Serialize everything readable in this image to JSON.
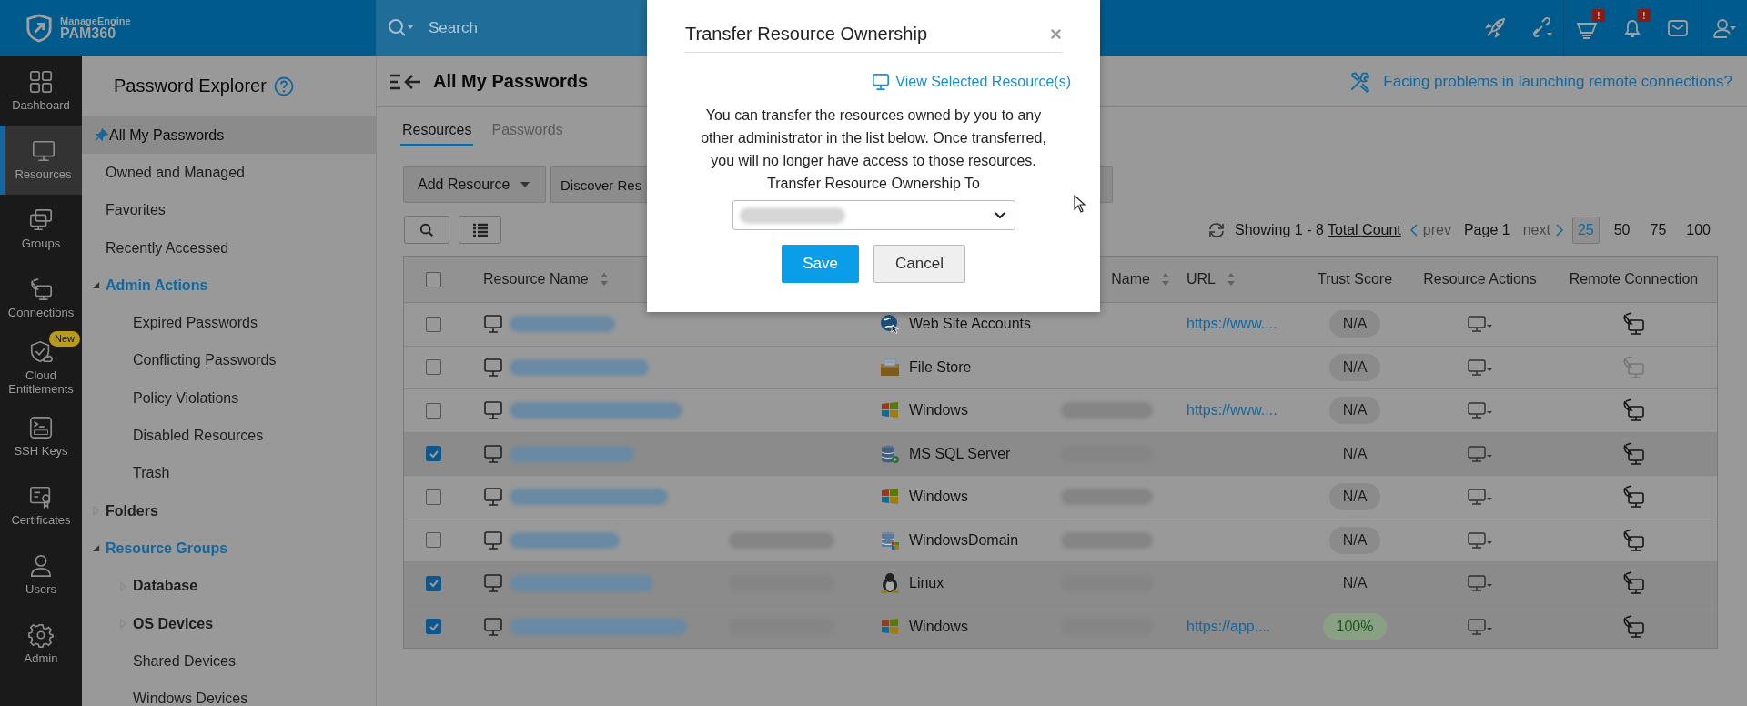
{
  "top_bar": {
    "logo_brand": "ManageEngine",
    "logo_product": "PAM360",
    "search_placeholder": "Search",
    "basket_badge": "!",
    "bell_badge": "!"
  },
  "nav_rail": [
    {
      "label": "Dashboard",
      "selected": false
    },
    {
      "label": "Resources",
      "selected": true
    },
    {
      "label": "Groups",
      "selected": false
    },
    {
      "label": "Connections",
      "selected": false
    },
    {
      "label": "Cloud Entitlements",
      "selected": false,
      "badge": "New"
    },
    {
      "label": "SSH Keys",
      "selected": false
    },
    {
      "label": "Certificates",
      "selected": false
    },
    {
      "label": "Users",
      "selected": false
    },
    {
      "label": "Admin",
      "selected": false
    }
  ],
  "explorer": {
    "title": "Password Explorer",
    "items": [
      {
        "label": "All My Passwords",
        "selected": true
      },
      {
        "label": "Owned and Managed",
        "selected": false
      },
      {
        "label": "Favorites",
        "selected": false
      },
      {
        "label": "Recently Accessed",
        "selected": false
      },
      {
        "label": "Admin Actions",
        "selected": false,
        "expanded": true,
        "children": [
          {
            "label": "Expired Passwords",
            "selected": false
          },
          {
            "label": "Conflicting Passwords",
            "selected": false
          },
          {
            "label": "Policy Violations",
            "selected": false
          },
          {
            "label": "Disabled Resources",
            "selected": false
          },
          {
            "label": "Trash",
            "selected": false
          }
        ]
      },
      {
        "label": "Folders",
        "selected": false,
        "expanded": false
      },
      {
        "label": "Resource Groups",
        "selected": false,
        "expanded": true,
        "children": [
          {
            "label": "Database",
            "selected": false,
            "expanded": false
          },
          {
            "label": "OS Devices",
            "selected": false,
            "expanded": false
          },
          {
            "label": "Shared Devices",
            "selected": false
          },
          {
            "label": "Windows Devices",
            "selected": false
          }
        ]
      }
    ]
  },
  "main": {
    "title": "All My Passwords",
    "help_link": "Facing problems in launching remote connections?",
    "tabs": [
      {
        "label": "Resources",
        "selected": true
      },
      {
        "label": "Passwords",
        "selected": false
      }
    ],
    "buttons": [
      "Add Resource",
      "Discover Res"
    ],
    "pagination": {
      "showing": "Showing 1 - 8",
      "total_link": "Total Count",
      "prev": "prev",
      "page": "Page 1",
      "next": "next",
      "sizes": [
        {
          "label": "25",
          "selected": true
        },
        {
          "label": "50",
          "selected": false
        },
        {
          "label": "75",
          "selected": false
        },
        {
          "label": "100",
          "selected": false
        }
      ]
    },
    "table": {
      "select_all_checked": false,
      "columns": [
        {
          "label": "Resource Name",
          "sortable": true
        },
        {
          "label": "Name",
          "sortable": true
        },
        {
          "label": "URL",
          "sortable": true
        },
        {
          "label": "Trust Score",
          "sortable": false
        },
        {
          "label": "Resource Actions",
          "sortable": false
        },
        {
          "label": "Remote Connection",
          "sortable": false
        }
      ],
      "rows": [
        {
          "checked": false,
          "description_blurred": false,
          "type": {
            "kind": "web",
            "text": "Web Site Accounts"
          },
          "dns_blurred": false,
          "url": "https://www....",
          "trust": {
            "kind": "na",
            "text": "N/A"
          },
          "remote_enabled": true
        },
        {
          "checked": false,
          "description_blurred": false,
          "type": {
            "kind": "file",
            "text": "File Store"
          },
          "dns_blurred": false,
          "trust": {
            "kind": "na",
            "text": "N/A"
          },
          "remote_enabled": false
        },
        {
          "checked": false,
          "description_blurred": false,
          "type": {
            "kind": "windows",
            "text": "Windows"
          },
          "dns_blurred": true,
          "url": "https://www....",
          "trust": {
            "kind": "na",
            "text": "N/A"
          },
          "remote_enabled": true
        },
        {
          "checked": true,
          "description_blurred": false,
          "type": {
            "kind": "sql",
            "text": "MS SQL Server"
          },
          "dns_blurred": true,
          "trust": {
            "kind": "na",
            "text": "N/A"
          },
          "remote_enabled": true
        },
        {
          "checked": false,
          "description_blurred": false,
          "type": {
            "kind": "windows",
            "text": "Windows"
          },
          "dns_blurred": true,
          "trust": {
            "kind": "na",
            "text": "N/A"
          },
          "remote_enabled": true
        },
        {
          "checked": false,
          "description_blurred": true,
          "type": {
            "kind": "domain",
            "text": "WindowsDomain"
          },
          "dns_blurred": true,
          "trust": {
            "kind": "na",
            "text": "N/A"
          },
          "remote_enabled": true
        },
        {
          "checked": true,
          "description_blurred": true,
          "type": {
            "kind": "linux",
            "text": "Linux"
          },
          "dns_blurred": true,
          "trust": {
            "kind": "na",
            "text": "N/A"
          },
          "remote_enabled": true
        },
        {
          "checked": true,
          "description_blurred": true,
          "type": {
            "kind": "windows",
            "text": "Windows"
          },
          "dns_blurred": true,
          "url": "https://app....",
          "trust": {
            "kind": "good",
            "text": "100%"
          },
          "remote_enabled": true
        }
      ]
    }
  },
  "dialog": {
    "title": "Transfer Resource Ownership",
    "link": "View Selected Resource(s)",
    "message": "You can transfer the resources owned by you to any other administrator in the list below. Once transferred, you will no longer have access to those resources.",
    "field_label": "Transfer Resource Ownership To",
    "buttons": [
      "Save",
      "Cancel"
    ]
  }
}
